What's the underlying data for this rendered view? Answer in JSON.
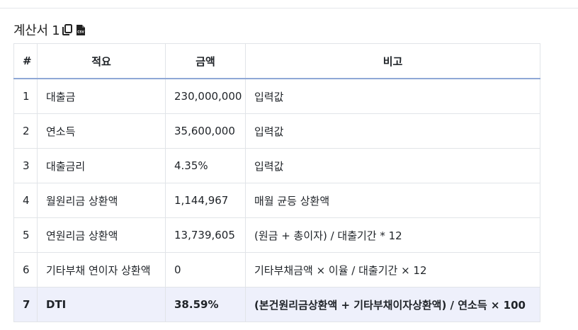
{
  "calculation": {
    "title": "계산서 1",
    "copy_icon": "copy-icon",
    "csv_icon": "csv-file-icon",
    "csv_icon_text": "CSV",
    "headers": [
      "#",
      "적요",
      "금액",
      "비고"
    ],
    "rows": [
      {
        "no": "1",
        "item": "대출금",
        "amount": "230,000,000",
        "note": "입력값"
      },
      {
        "no": "2",
        "item": "연소득",
        "amount": "35,600,000",
        "note": "입력값"
      },
      {
        "no": "3",
        "item": "대출금리",
        "amount": "4.35%",
        "note": "입력값"
      },
      {
        "no": "4",
        "item": "월원리금 상환액",
        "amount": "1,144,967",
        "note": "매월 균등 상환액"
      },
      {
        "no": "5",
        "item": "연원리금 상환액",
        "amount": "13,739,605",
        "note": "(원금 + 총이자) / 대출기간 * 12"
      },
      {
        "no": "6",
        "item": "기타부채 연이자 상환액",
        "amount": "0",
        "note": "기타부채금액 × 이율 / 대출기간 × 12"
      },
      {
        "no": "7",
        "item": "DTI",
        "amount": "38.59%",
        "note": "(본건원리금상환액 + 기타부채이자상환액) / 연소득 × 100"
      }
    ],
    "highlight_row": 7,
    "colors": {
      "highlight_bg": "#eef0fb",
      "header_border": "#8fa8d6",
      "grid": "#e1e4e8"
    }
  }
}
